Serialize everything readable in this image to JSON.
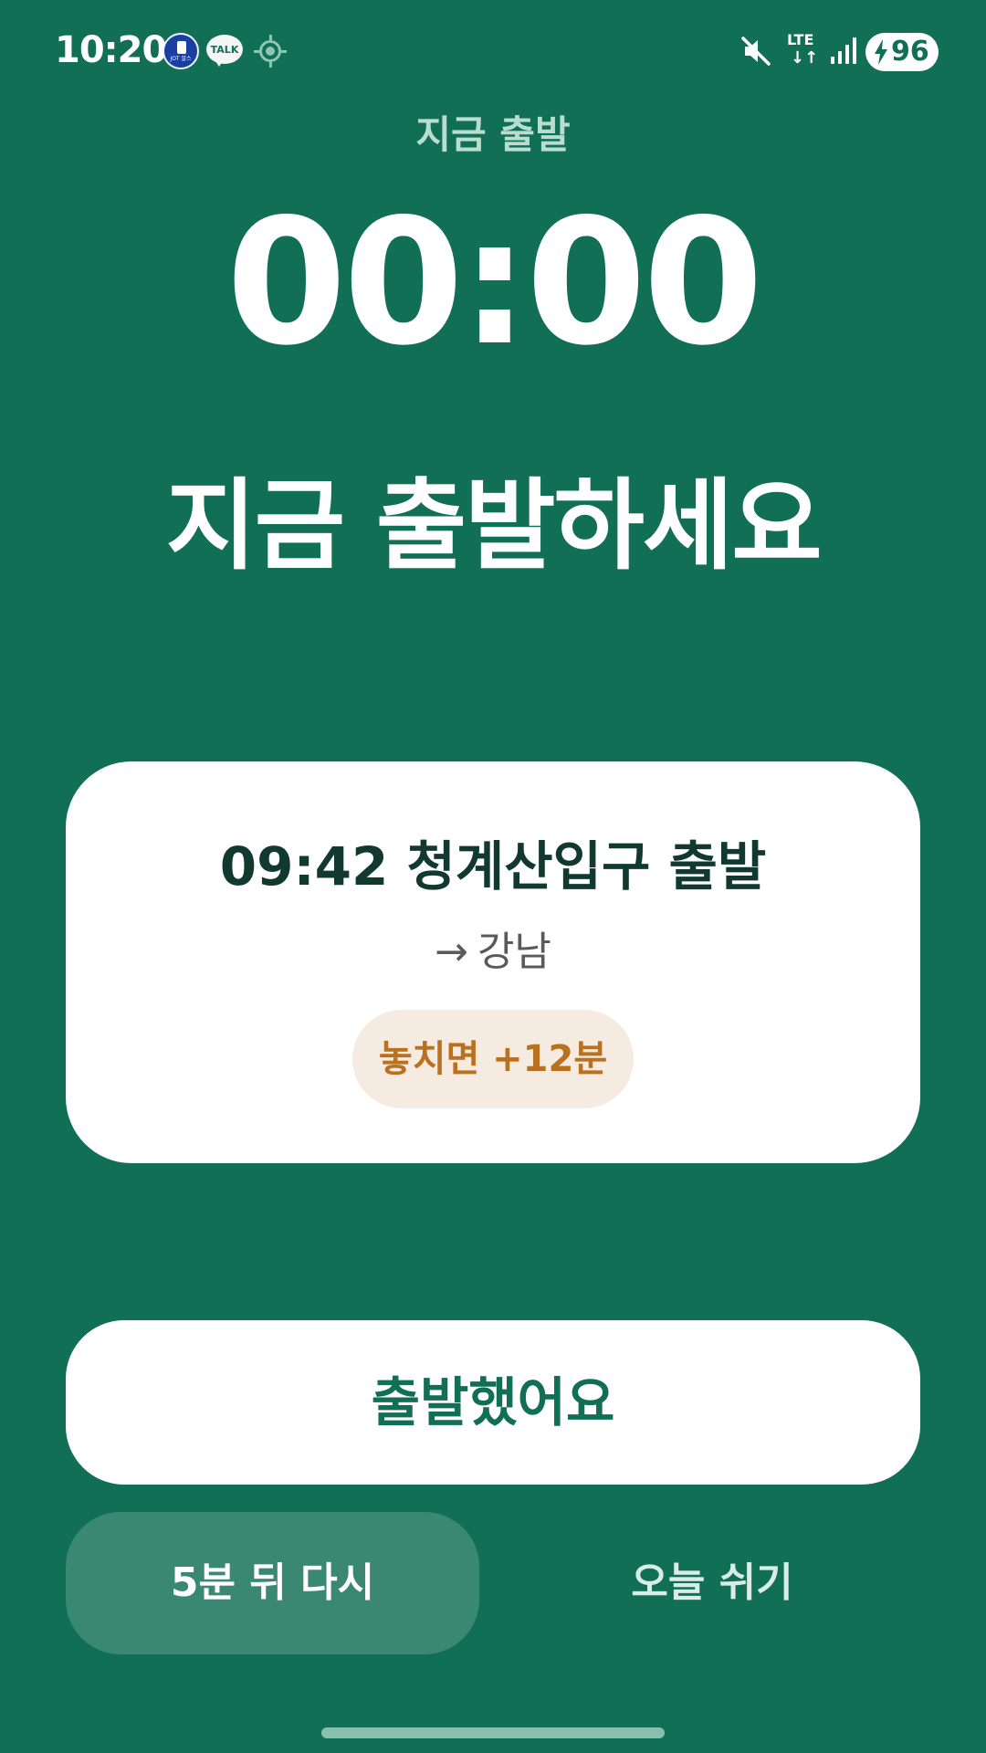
{
  "status_bar": {
    "time": "10:20",
    "battery_level": "96",
    "network": "LTE",
    "icons": [
      "app-notification-icon",
      "kakaotalk-icon",
      "location-icon",
      "mute-icon",
      "lte-icon",
      "signal-icon",
      "battery-charging-icon"
    ],
    "notif_app_text": "JOT 알스",
    "notif_talk_text": "TALK"
  },
  "main": {
    "top_label": "지금 출발",
    "timer": "00:00",
    "headline": "지금 출발하세요"
  },
  "card": {
    "title": "09:42 청계산입구 출발",
    "route_arrow": "→",
    "destination": "강남",
    "penalty": "놓치면 +12분"
  },
  "actions": {
    "depart_label": "출발했어요",
    "snooze_label": "5분 뒤 다시",
    "skip_label": "오늘 쉬기"
  },
  "colors": {
    "background": "#116f55",
    "card": "#ffffff",
    "accent_text": "#116f55",
    "penalty_text": "#b9701f",
    "penalty_bg": "#f6ebe1"
  }
}
